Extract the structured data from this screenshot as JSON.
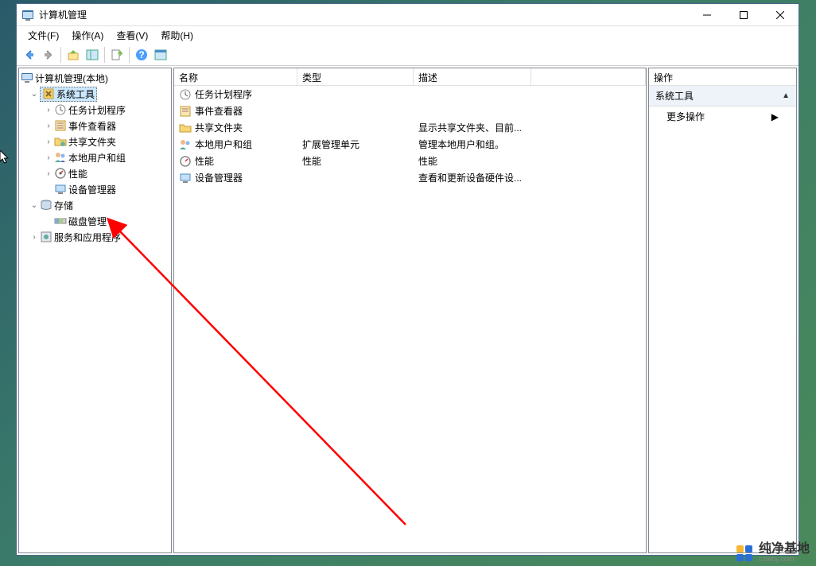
{
  "window": {
    "title": "计算机管理"
  },
  "menu": {
    "file": "文件(F)",
    "action": "操作(A)",
    "view": "查看(V)",
    "help": "帮助(H)"
  },
  "tree": {
    "root": "计算机管理(本地)",
    "system_tools": "系统工具",
    "task_scheduler": "任务计划程序",
    "event_viewer": "事件查看器",
    "shared_folders": "共享文件夹",
    "local_users": "本地用户和组",
    "performance": "性能",
    "device_manager": "设备管理器",
    "storage": "存储",
    "disk_management": "磁盘管理",
    "services_apps": "服务和应用程序"
  },
  "list": {
    "headers": {
      "name": "名称",
      "type": "类型",
      "desc": "描述"
    },
    "rows": [
      {
        "name": "任务计划程序",
        "type": "",
        "desc": ""
      },
      {
        "name": "事件查看器",
        "type": "",
        "desc": ""
      },
      {
        "name": "共享文件夹",
        "type": "",
        "desc": "显示共享文件夹、目前..."
      },
      {
        "name": "本地用户和组",
        "type": "扩展管理单元",
        "desc": "管理本地用户和组。"
      },
      {
        "name": "性能",
        "type": "性能",
        "desc": "性能"
      },
      {
        "name": "设备管理器",
        "type": "",
        "desc": "查看和更新设备硬件设..."
      }
    ]
  },
  "actions": {
    "title": "操作",
    "section": "系统工具",
    "more": "更多操作"
  },
  "watermark": {
    "main": "纯净基地",
    "sub": "czlaby.com"
  }
}
